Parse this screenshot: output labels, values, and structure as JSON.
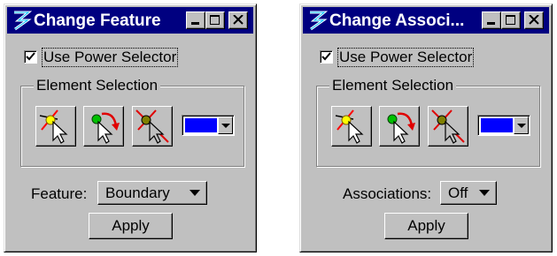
{
  "colors": {
    "titlebar": "#000080",
    "face": "#c0c0c0",
    "swatch": "#0000ff"
  },
  "dialogs": [
    {
      "title": "Change Feature",
      "use_power_selector": {
        "label": "Use Power Selector",
        "checked": true
      },
      "group_title": "Element Selection",
      "tools": [
        {
          "icon": "select-element-tool-icon"
        },
        {
          "icon": "add-to-selection-tool-icon"
        },
        {
          "icon": "remove-from-selection-tool-icon"
        }
      ],
      "field_label": "Feature:",
      "field_value": "Boundary",
      "apply_label": "Apply"
    },
    {
      "title": "Change Associ...",
      "use_power_selector": {
        "label": "Use Power Selector",
        "checked": true
      },
      "group_title": "Element Selection",
      "tools": [
        {
          "icon": "select-element-tool-icon"
        },
        {
          "icon": "add-to-selection-tool-icon"
        },
        {
          "icon": "remove-from-selection-tool-icon"
        }
      ],
      "field_label": "Associations:",
      "field_value": "Off",
      "apply_label": "Apply"
    }
  ]
}
